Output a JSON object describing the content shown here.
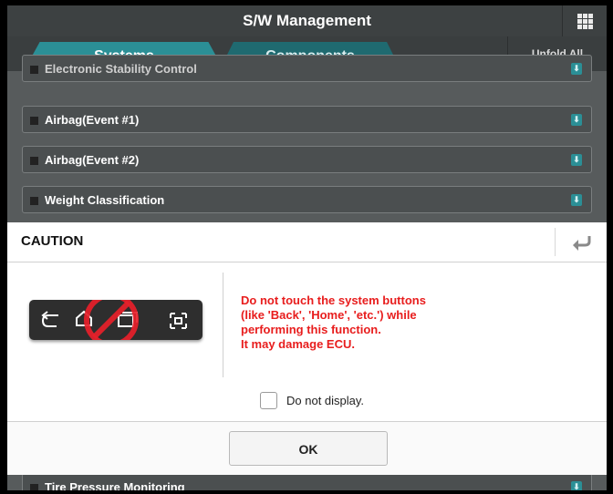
{
  "header": {
    "title": "S/W Management",
    "menu_icon": "grid-icon"
  },
  "tabs": [
    {
      "label": "Systems",
      "active": true
    },
    {
      "label": "Components",
      "active": false
    }
  ],
  "unfold_label": "Unfold All",
  "list": {
    "items": [
      {
        "label": "Electronic Stability Control"
      },
      {
        "label": "Airbag(Event #1)"
      },
      {
        "label": "Airbag(Event #2)"
      },
      {
        "label": "Weight Classification"
      },
      {
        "label": "Tire Pressure Monitoring"
      }
    ]
  },
  "dialog": {
    "title": "CAUTION",
    "message_lines": [
      "Do not touch the system buttons",
      "(like 'Back', 'Home', 'etc.') while",
      "performing this function.",
      "It may damage ECU."
    ],
    "checkbox_label": "Do not display.",
    "checkbox_checked": false,
    "ok_label": "OK"
  },
  "colors": {
    "accent": "#2b8f96",
    "warning": "#e81d1d",
    "dialog_bg": "#ffffff"
  }
}
